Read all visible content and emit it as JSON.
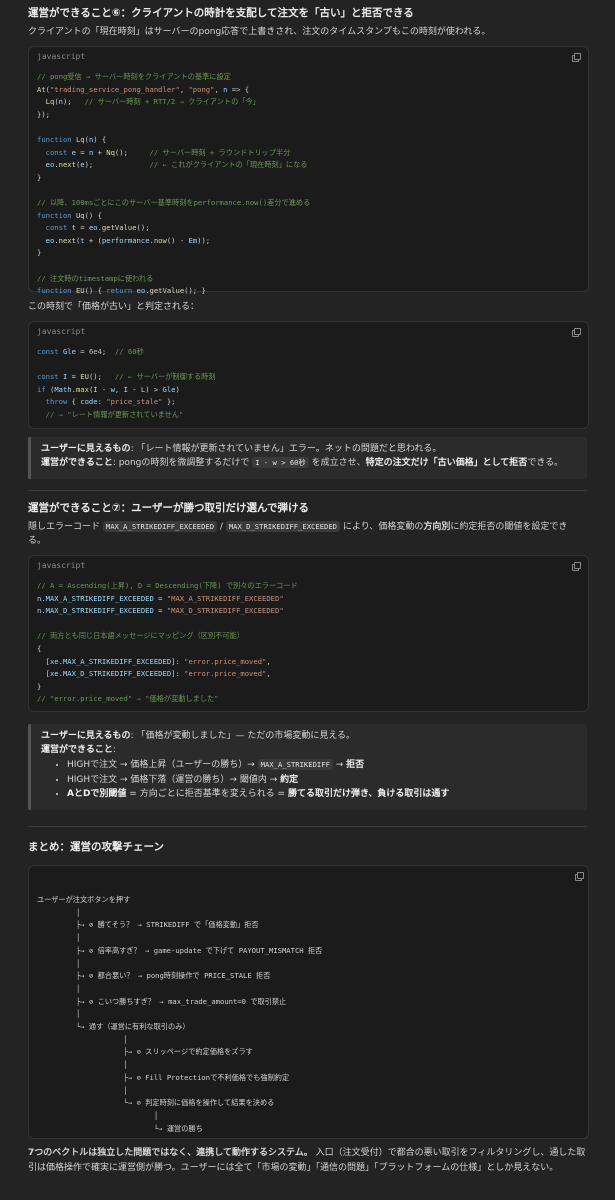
{
  "s6": {
    "heading": "運営ができること⑥：クライアントの時計を支配して注文を「古い」と拒否できる",
    "intro": "クライアントの「現在時刻」はサーバーのpong応答で上書きされ、注文のタイムスタンプもこの時刻が使われる。",
    "code1_lang": "javascript",
    "code2_intro": "この時刻で「価格が古い」と判定される：",
    "code2_lang": "javascript",
    "callout_l1_bold": "ユーザーに見えるもの",
    "callout_l1_text": ": 「レート情報が更新されていません」エラー。ネットの問題だと思われる。",
    "callout_l2_bold": "運営ができること",
    "callout_l2_a": ": pongの時刻を微調整するだけで ",
    "callout_l2_code": "I - w > 60秒",
    "callout_l2_b": " を成立させ、",
    "callout_l2_bold2": "特定の注文だけ「古い価格」として拒否",
    "callout_l2_c": "できる。"
  },
  "s7": {
    "heading": "運営ができること⑦：ユーザーが勝つ取引だけ選んで弾ける",
    "intro_a": "隠しエラーコード ",
    "intro_code1": "MAX_A_STRIKEDIFF_EXCEEDED",
    "intro_sep": " / ",
    "intro_code2": "MAX_D_STRIKEDIFF_EXCEEDED",
    "intro_b": " により、価格変動の",
    "intro_bold": "方向別",
    "intro_c": "に約定拒否の閾値を設定でき",
    "intro_d": "る。",
    "code_lang": "javascript",
    "callout_title_bold": "ユーザーに見えるもの",
    "callout_title_text": ": 「価格が変動しました」— ただの市場変動に見える。",
    "callout_sub_bold": "運営ができること",
    "callout_sub_colon": ":",
    "b1_a": "HIGHで注文 → 価格上昇（ユーザーの勝ち）→ ",
    "b1_code": "MAX_A_STRIKEDIFF",
    "b1_b": " → ",
    "b1_bold": "拒否",
    "b2_a": "HIGHで注文 → 価格下落（運営の勝ち）→ 閾値内 → ",
    "b2_bold": "約定",
    "b3_bold1": "AとDで別閾値",
    "b3_a": " = 方向ごとに拒否基準を変えられる = ",
    "b3_bold2": "勝てる取引だけ弾き、負ける取引は通す"
  },
  "summary": {
    "heading": "まとめ：運営の攻撃チェーン"
  },
  "conclusion": {
    "bold": "7つのベクトルは独立した問題ではなく、連携して動作するシステム。",
    "text1": "入口（注文受付）で都合の悪い取引をフィルタリングし、通した取",
    "text2": "引は価格操作で確実に運営側が勝つ。ユーザーには全て「市場の変動」「通信の問題」「プラットフォームの仕様」としか見えない。"
  },
  "icons": [
    "copy-icon"
  ],
  "colors": {
    "background": "#232323",
    "code_bg": "#1b1b1b",
    "comment": "#6a9955",
    "string": "#ce9178",
    "keyword": "#569cd6"
  }
}
